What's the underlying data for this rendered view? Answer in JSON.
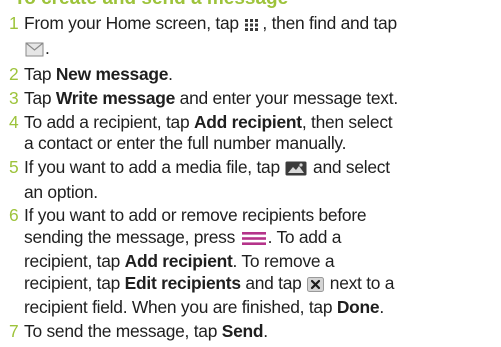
{
  "heading": "To create and send a message",
  "steps": [
    {
      "num": "1",
      "line1": [
        "From your Home screen, tap ",
        {
          "icon": "app-grid-icon"
        },
        ", then find and tap"
      ],
      "line2": [
        {
          "icon": "envelope-icon"
        },
        "."
      ]
    },
    {
      "num": "2",
      "parts": [
        "Tap ",
        {
          "b": "New message"
        },
        "."
      ]
    },
    {
      "num": "3",
      "parts": [
        "Tap ",
        {
          "b": "Write message"
        },
        " and enter your message text."
      ]
    },
    {
      "num": "4",
      "parts": [
        "To add a recipient, tap ",
        {
          "b": "Add recipient"
        },
        ", then select"
      ],
      "cont": [
        "a contact or enter the full number manually."
      ]
    },
    {
      "num": "5",
      "parts": [
        "If you want to add a media file, tap ",
        {
          "icon": "media-icon"
        },
        " and select"
      ],
      "cont": [
        "an option."
      ]
    },
    {
      "num": "6",
      "parts": [
        "If you want to add or remove recipients before"
      ],
      "cont": [
        "sending the message, press ",
        {
          "icon": "menu-icon"
        },
        ". To add a"
      ],
      "cont2": [
        "recipient, tap ",
        {
          "b": "Add recipient"
        },
        ". To remove a"
      ],
      "cont3": [
        "recipient, tap ",
        {
          "b": "Edit recipients"
        },
        " and tap ",
        {
          "icon": "remove-icon"
        },
        " next to a"
      ],
      "cont4": [
        "recipient field. When you are finished, tap ",
        {
          "b": "Done"
        },
        "."
      ]
    },
    {
      "num": "7",
      "parts": [
        "To send the message, tap ",
        {
          "b": "Send"
        },
        "."
      ]
    }
  ],
  "colors": {
    "accent": "#9dc33b",
    "text": "#1f1f1f"
  }
}
